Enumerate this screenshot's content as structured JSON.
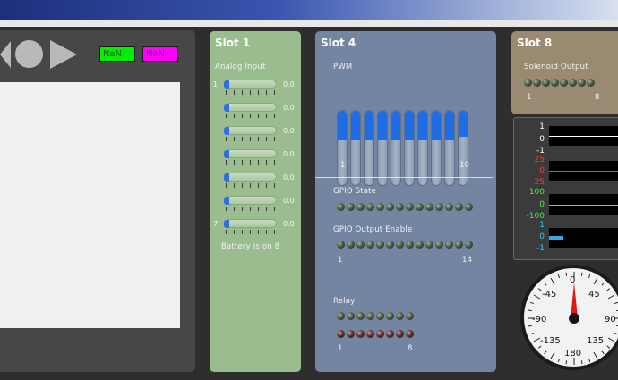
{
  "left_panel": {
    "nan_green": "NaN",
    "nan_magenta": "NaN"
  },
  "slot1": {
    "title": "Slot 1",
    "section": "Analog Input",
    "first_index": "1",
    "last_index": "7",
    "inputs": [
      {
        "value": "0.0"
      },
      {
        "value": "0.0"
      },
      {
        "value": "0.0"
      },
      {
        "value": "0.0"
      },
      {
        "value": "0.0"
      },
      {
        "value": "0.0"
      },
      {
        "value": "0.0"
      }
    ],
    "footer": "Battery is on 8"
  },
  "slot4": {
    "title": "Slot 4",
    "pwm_label": "PWM",
    "pwm_first": "1",
    "pwm_last": "10",
    "pwm_levels": [
      0.4,
      0.4,
      0.4,
      0.4,
      0.4,
      0.4,
      0.4,
      0.4,
      0.4,
      0.35
    ],
    "gpio_state_label": "GPIO State",
    "gpio_enable_label": "GPIO Output Enable",
    "gpio_first": "1",
    "gpio_last": "14",
    "relay_label": "Relay",
    "relay_first": "1",
    "relay_last": "8"
  },
  "slot8": {
    "title": "Slot 8",
    "section": "Solenoid Output",
    "first": "1",
    "last": "8"
  },
  "charts": {
    "ticks": [
      {
        "text": "1",
        "color": "#ffffff"
      },
      {
        "text": "0",
        "color": "#ffffff"
      },
      {
        "text": "-1",
        "color": "#ffffff"
      },
      {
        "text": "25",
        "color": "#ff3b3b"
      },
      {
        "text": "0",
        "color": "#ff3b3b"
      },
      {
        "text": "-25",
        "color": "#ff3b3b"
      },
      {
        "text": "100",
        "color": "#44ee44"
      },
      {
        "text": "0",
        "color": "#44ee44"
      },
      {
        "text": "-100",
        "color": "#44ee44"
      },
      {
        "text": "1",
        "color": "#39c6e6"
      },
      {
        "text": "0",
        "color": "#39c6e6"
      },
      {
        "text": "-1",
        "color": "#39c6e6"
      }
    ]
  },
  "gauge": {
    "labels": [
      "-45",
      "45",
      "-90",
      "90",
      "-135",
      "135",
      "180",
      "0"
    ],
    "needle_color": "#e01515"
  }
}
